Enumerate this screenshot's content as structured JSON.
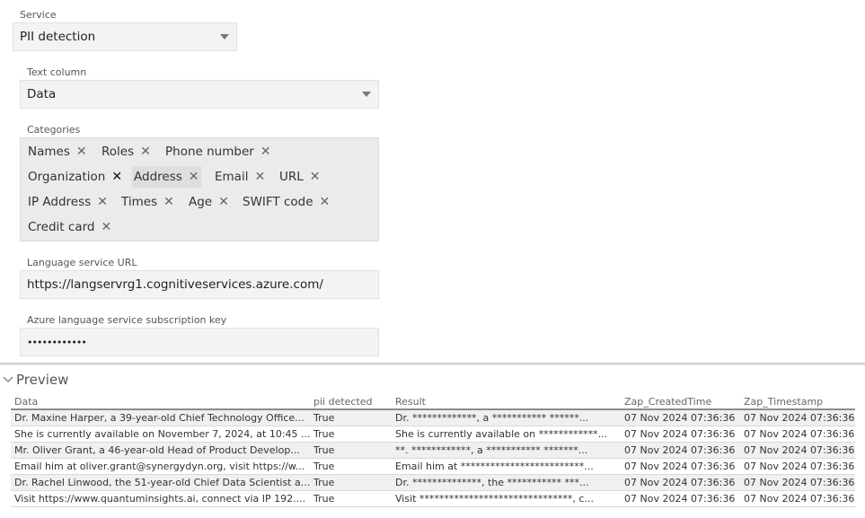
{
  "service": {
    "label": "Service",
    "value": "PII detection"
  },
  "text_column": {
    "label": "Text column",
    "value": "Data"
  },
  "categories": {
    "label": "Categories",
    "items": [
      {
        "label": "Names"
      },
      {
        "label": "Roles"
      },
      {
        "label": "Phone number"
      },
      {
        "label": "Organization"
      },
      {
        "label": "Address"
      },
      {
        "label": "Email"
      },
      {
        "label": "URL"
      },
      {
        "label": "IP Address"
      },
      {
        "label": "Times"
      },
      {
        "label": "Age"
      },
      {
        "label": "SWIFT code"
      },
      {
        "label": "Credit card"
      }
    ],
    "remove_glyph": "✕"
  },
  "language_url": {
    "label": "Language service URL",
    "value": "https://langservrg1.cognitiveservices.azure.com/"
  },
  "subscription_key": {
    "label": "Azure language service subscription key",
    "value": "••••••••••••"
  },
  "preview": {
    "title": "Preview",
    "columns": [
      "Data",
      "pii detected",
      "Result",
      "Zap_CreatedTime",
      "Zap_Timestamp"
    ],
    "rows": [
      [
        "Dr. Maxine Harper, a 39-year-old Chief Technology Office...",
        "True",
        "Dr. *************, a *********** ******...",
        "07 Nov 2024 07:36:36",
        "07 Nov 2024 07:36:36"
      ],
      [
        "She is currently available on November 7, 2024, at 10:45 ...",
        "True",
        "She is currently available on ************...",
        "07 Nov 2024 07:36:36",
        "07 Nov 2024 07:36:36"
      ],
      [
        "Mr. Oliver Grant, a 46-year-old Head of Product Develop...",
        "True",
        "**. ************, a *********** *******...",
        "07 Nov 2024 07:36:36",
        "07 Nov 2024 07:36:36"
      ],
      [
        "Email him at oliver.grant@synergydyn.org, visit https://w...",
        "True",
        "Email him at *************************...",
        "07 Nov 2024 07:36:36",
        "07 Nov 2024 07:36:36"
      ],
      [
        "Dr. Rachel Linwood, the 51-year-old Chief Data Scientist a...",
        "True",
        "Dr. **************, the *********** ***...",
        "07 Nov 2024 07:36:36",
        "07 Nov 2024 07:36:36"
      ],
      [
        "Visit https://www.quantuminsights.ai, connect via IP 192....",
        "True",
        "Visit *******************************, c...",
        "07 Nov 2024 07:36:36",
        "07 Nov 2024 07:36:36"
      ]
    ]
  }
}
